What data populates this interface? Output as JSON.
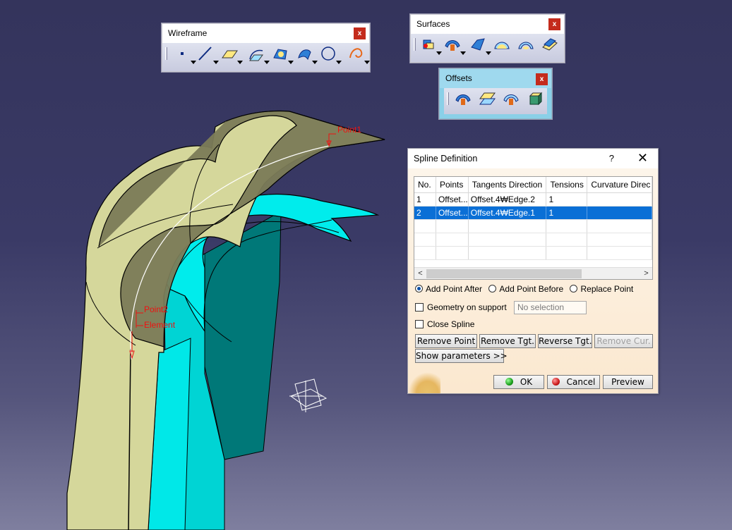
{
  "toolbars": {
    "wireframe": {
      "title": "Wireframe",
      "close": "x",
      "icons": [
        "point-icon",
        "line-icon",
        "plane-icon",
        "projection-icon",
        "circle-arc-icon",
        "helix-surface-icon",
        "circle-icon",
        "spline-icon"
      ]
    },
    "surfaces": {
      "title": "Surfaces",
      "close": "x",
      "icons": [
        "extrude-icon",
        "offset-surface-icon",
        "sweep-icon",
        "fill-icon",
        "loft-icon",
        "blend-icon"
      ]
    },
    "offsets": {
      "title": "Offsets",
      "close": "x",
      "icons": [
        "offset-icon",
        "variable-offset-icon",
        "rough-offset-icon",
        "thick-surface-icon"
      ]
    }
  },
  "scene": {
    "labels": {
      "point1": "Point1",
      "point2": "Point2",
      "element": "Element"
    },
    "colors": {
      "surface_light": "#d7d99e",
      "surface_dark": "#7c7c58",
      "cyan_surface": "#00e6e6",
      "cyan_dark": "#007373",
      "background": "#35355e"
    }
  },
  "dialog": {
    "title": "Spline Definition",
    "help": "?",
    "close": "✕",
    "table": {
      "columns": [
        "No.",
        "Points",
        "Tangents Direction",
        "Tensions",
        "Curvature Direc"
      ],
      "rows": [
        {
          "no": "1",
          "points": "Offset...",
          "tangent": "Offset.4₩Edge.2",
          "tension": "1",
          "curvature": ""
        },
        {
          "no": "2",
          "points": "Offset...",
          "tangent": "Offset.4₩Edge.1",
          "tension": "1",
          "curvature": ""
        }
      ],
      "scroll_left": "<",
      "scroll_right": ">"
    },
    "radios": [
      "Add Point After",
      "Add Point Before",
      "Replace Point"
    ],
    "checkbox_geometry": "Geometry on support",
    "no_selection": "No selection",
    "checkbox_close": "Close Spline",
    "buttons": {
      "remove_point": "Remove Point",
      "remove_tgt": "Remove Tgt.",
      "reverse_tgt": "Reverse Tgt.",
      "remove_cur": "Remove Cur.",
      "show_params": "Show parameters >>",
      "ok": "OK",
      "cancel": "Cancel",
      "preview": "Preview"
    }
  }
}
